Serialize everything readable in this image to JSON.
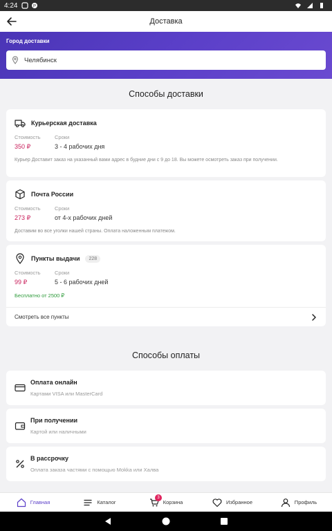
{
  "status_bar": {
    "time": "4:24"
  },
  "header": {
    "title": "Доставка"
  },
  "city": {
    "label": "Город доставки",
    "value": "Челябинск"
  },
  "delivery": {
    "section_title": "Способы доставки",
    "methods": [
      {
        "name": "Курьерская доставка",
        "price_label": "Стоимость",
        "price": "350 ₽",
        "term_label": "Сроки",
        "term": "3 - 4 рабочих дня",
        "description": "Курьер Доставит заказ на указанный вами адрес в будние дни с 9 до 18. Вы можете осмотреть заказ при получении."
      },
      {
        "name": "Почта России",
        "price_label": "Стоимость",
        "price": "273 ₽",
        "term_label": "Сроки",
        "term": "от 4-х рабочих дней",
        "description": "Доставим во все уголки нашей страны. Оплата наложенным платежом."
      },
      {
        "name": "Пункты выдачи",
        "badge": "228",
        "price_label": "Стоимость",
        "price": "99 ₽",
        "term_label": "Сроки",
        "term": "5 - 6 рабочих дней",
        "free_note": "Бесплатно от 2500 ₽",
        "link": "Смотреть все пункты"
      }
    ]
  },
  "payment": {
    "section_title": "Способы оплаты",
    "methods": [
      {
        "name": "Оплата онлайн",
        "subtitle": "Картами VISA или MasterCard"
      },
      {
        "name": "При получении",
        "subtitle": "Картой или наличными"
      },
      {
        "name": "В рассрочку",
        "subtitle": "Оплата заказа частями с помощью Mokka или Халва"
      }
    ]
  },
  "bottom_nav": {
    "items": [
      {
        "label": "Главная",
        "icon": "home-icon"
      },
      {
        "label": "Каталог",
        "icon": "catalog-icon"
      },
      {
        "label": "Корзина",
        "icon": "cart-icon",
        "badge": "3"
      },
      {
        "label": "Избранное",
        "icon": "heart-icon"
      },
      {
        "label": "Профиль",
        "icon": "person-icon"
      }
    ]
  },
  "colors": {
    "accent": "#5b3fc8",
    "price": "#c9215c",
    "free": "#2d9a3a"
  }
}
